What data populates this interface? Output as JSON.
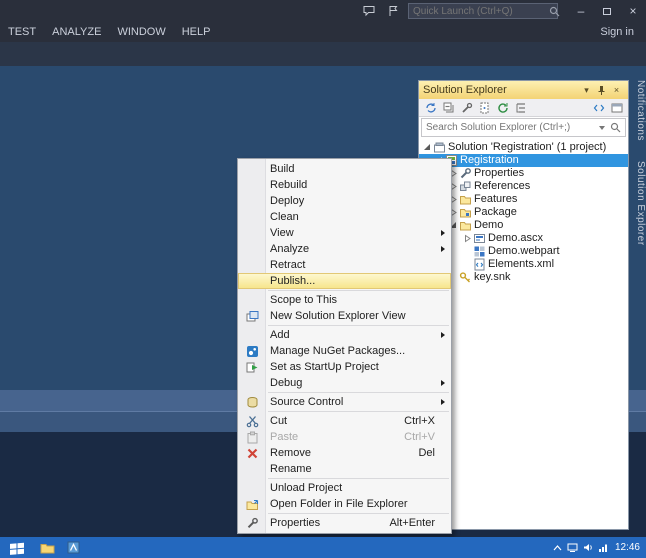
{
  "titlebar": {
    "quick_launch_placeholder": "Quick Launch (Ctrl+Q)",
    "icons": [
      "feedback-icon",
      "notifications-flag-icon",
      "minimize-icon",
      "restore-icon",
      "close-icon"
    ]
  },
  "menubar": {
    "items": [
      "TEST",
      "ANALYZE",
      "WINDOW",
      "HELP"
    ],
    "sign_in": "Sign in"
  },
  "solution_explorer": {
    "title": "Solution Explorer",
    "title_icons": [
      "window-position-icon",
      "pin-icon",
      "close-icon"
    ],
    "toolbar_icons": [
      "sync-icon",
      "collapse-all-icon",
      "properties-icon",
      "show-all-files-icon",
      "refresh-icon",
      "nest-files-icon",
      "view-code-icon",
      "preview-icon"
    ],
    "search_placeholder": "Search Solution Explorer (Ctrl+;)",
    "tree": [
      {
        "label": "Solution 'Registration' (1 project)",
        "icon": "solution-icon",
        "level": 0,
        "state": "expanded"
      },
      {
        "label": "Registration",
        "icon": "project-icon",
        "level": 1,
        "state": "expanded",
        "selected": true
      },
      {
        "label": "Properties",
        "icon": "properties-icon",
        "level": 2,
        "state": "collapsed"
      },
      {
        "label": "References",
        "icon": "references-icon",
        "level": 2,
        "state": "collapsed"
      },
      {
        "label": "Features",
        "icon": "folder-icon",
        "level": 2,
        "state": "collapsed"
      },
      {
        "label": "Package",
        "icon": "package-icon",
        "level": 2,
        "state": "collapsed"
      },
      {
        "label": "Demo",
        "icon": "folder-icon",
        "level": 2,
        "state": "expanded"
      },
      {
        "label": "Demo.ascx",
        "icon": "user-control-icon",
        "level": 3,
        "state": "collapsed"
      },
      {
        "label": "Demo.webpart",
        "icon": "webpart-icon",
        "level": 3,
        "state": "leaf"
      },
      {
        "label": "Elements.xml",
        "icon": "xml-icon",
        "level": 3,
        "state": "leaf"
      },
      {
        "label": "key.snk",
        "icon": "key-icon",
        "level": 2,
        "state": "leaf"
      }
    ]
  },
  "side_tabs": [
    {
      "label": "Notifications"
    },
    {
      "label": "Solution Explorer"
    }
  ],
  "context_menu": {
    "items": [
      {
        "label": "Build"
      },
      {
        "label": "Rebuild"
      },
      {
        "label": "Deploy"
      },
      {
        "label": "Clean"
      },
      {
        "label": "View",
        "submenu": true
      },
      {
        "label": "Analyze",
        "submenu": true
      },
      {
        "label": "Retract"
      },
      {
        "label": "Publish...",
        "highlighted": true
      },
      {
        "label": "Scope to This"
      },
      {
        "label": "New Solution Explorer View",
        "icon": "new-view-icon"
      },
      {
        "label": "Add",
        "submenu": true
      },
      {
        "label": "Manage NuGet Packages...",
        "icon": "nuget-icon"
      },
      {
        "label": "Set as StartUp Project",
        "icon": "set-startup-icon"
      },
      {
        "label": "Debug",
        "submenu": true
      },
      {
        "label": "Source Control",
        "icon": "source-control-icon",
        "submenu": true
      },
      {
        "label": "Cut",
        "shortcut": "Ctrl+X",
        "icon": "scissors-icon"
      },
      {
        "label": "Paste",
        "shortcut": "Ctrl+V",
        "icon": "clipboard-icon",
        "disabled": true
      },
      {
        "label": "Remove",
        "shortcut": "Del",
        "icon": "remove-icon"
      },
      {
        "label": "Rename"
      },
      {
        "label": "Unload Project"
      },
      {
        "label": "Open Folder in File Explorer",
        "icon": "open-folder-icon"
      },
      {
        "label": "Properties",
        "shortcut": "Alt+Enter",
        "icon": "wrench-icon"
      }
    ],
    "separators_after": [
      7,
      9,
      13,
      14,
      18,
      20
    ]
  },
  "taskbar": {
    "time": "12:46",
    "icons": [
      "start-button",
      "file-explorer-icon",
      "app-icon",
      "tray-up-arrow-icon",
      "status-icon",
      "speaker-icon",
      "network-icon"
    ]
  },
  "colors": {
    "titlebar_bg": "#2A2F3B",
    "main_bg": "#2A4A6E",
    "panel_title_gold": "#F3D375",
    "selection_blue": "#3095E0",
    "menu_highlight": "#F6E488",
    "taskbar_blue": "#2468BE"
  }
}
